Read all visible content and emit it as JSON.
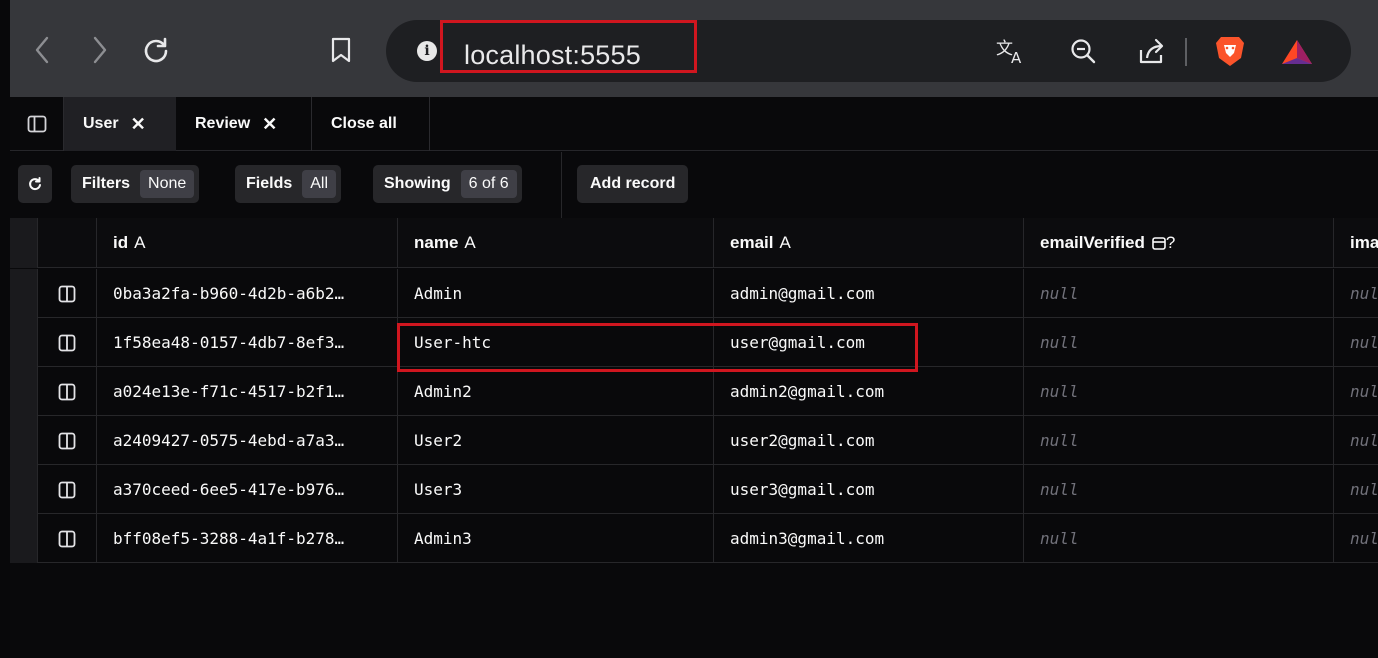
{
  "browser": {
    "url": "localhost:5555",
    "accent_color": "#d0161f"
  },
  "tabs": {
    "items": [
      {
        "label": "User",
        "active": true
      },
      {
        "label": "Review",
        "active": false
      }
    ],
    "close_all_label": "Close all"
  },
  "toolbar": {
    "filters_label": "Filters",
    "filters_value": "None",
    "fields_label": "Fields",
    "fields_value": "All",
    "showing_label": "Showing",
    "showing_value": "6 of 6",
    "add_record_label": "Add record"
  },
  "table": {
    "columns": [
      {
        "name": "id",
        "type": "A"
      },
      {
        "name": "name",
        "type": "A"
      },
      {
        "name": "email",
        "type": "A"
      },
      {
        "name": "emailVerified",
        "type": "?"
      },
      {
        "name": "imag",
        "type": ""
      }
    ],
    "rows": [
      {
        "id": "0ba3a2fa-b960-4d2b-a6b2…",
        "name": "Admin",
        "email": "admin@gmail.com",
        "emailVerified": "null",
        "image": "nul"
      },
      {
        "id": "1f58ea48-0157-4db7-8ef3…",
        "name": "User-htc",
        "email": "user@gmail.com",
        "emailVerified": "null",
        "image": "nul"
      },
      {
        "id": "a024e13e-f71c-4517-b2f1…",
        "name": "Admin2",
        "email": "admin2@gmail.com",
        "emailVerified": "null",
        "image": "nul"
      },
      {
        "id": "a2409427-0575-4ebd-a7a3…",
        "name": "User2",
        "email": "user2@gmail.com",
        "emailVerified": "null",
        "image": "nul"
      },
      {
        "id": "a370ceed-6ee5-417e-b976…",
        "name": "User3",
        "email": "user3@gmail.com",
        "emailVerified": "null",
        "image": "nul"
      },
      {
        "id": "bff08ef5-3288-4a1f-b278…",
        "name": "Admin3",
        "email": "admin3@gmail.com",
        "emailVerified": "null",
        "image": "nul"
      }
    ]
  }
}
